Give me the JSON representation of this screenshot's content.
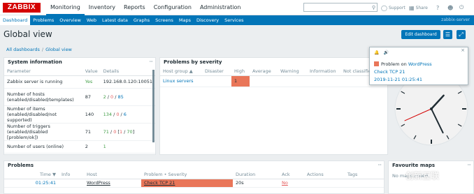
{
  "header": {
    "logo": "ZABBIX",
    "nav": [
      "Monitoring",
      "Inventory",
      "Reports",
      "Configuration",
      "Administration"
    ],
    "active_nav": "Monitoring",
    "support": "Support",
    "share": "Share",
    "help": "?",
    "user_icon": "user-icon",
    "logout_icon": "power-icon"
  },
  "subnav": {
    "items": [
      "Dashboard",
      "Problems",
      "Overview",
      "Web",
      "Latest data",
      "Graphs",
      "Screens",
      "Maps",
      "Discovery",
      "Services"
    ],
    "active": "Dashboard",
    "server_name": "zabbix-server"
  },
  "page": {
    "title": "Global view",
    "edit_button": "Edit dashboard",
    "breadcrumb": [
      "All dashboards",
      "Global view"
    ]
  },
  "system_info": {
    "title": "System information",
    "columns": [
      "Parameter",
      "Value",
      "Details"
    ],
    "rows": [
      {
        "param": "Zabbix server is running",
        "value": "Yes",
        "details": "192.168.0.120:10051"
      },
      {
        "param": "Number of hosts (enabled/disabled/templates)",
        "value": "87",
        "d1": "2",
        "d2": "0",
        "d3": "85"
      },
      {
        "param": "Number of items (enabled/disabled/not supported)",
        "value": "140",
        "d1": "134",
        "d2": "0",
        "d3": "6"
      },
      {
        "param": "Number of triggers (enabled/disabled [problem/ok])",
        "value": "71",
        "d1": "71",
        "d2": "0",
        "d3": "1",
        "d4": "70"
      },
      {
        "param": "Number of users (online)",
        "value": "2",
        "d1": "1"
      }
    ]
  },
  "severity": {
    "title": "Problems by severity",
    "columns": [
      "Host group ▲",
      "Disaster",
      "High",
      "Average",
      "Warning",
      "Information",
      "Not classified"
    ],
    "row": {
      "group": "Linux servers",
      "disaster": "",
      "high": "1",
      "average": "",
      "warning": "",
      "information": "",
      "not_classified": ""
    }
  },
  "problems": {
    "title": "Problems",
    "columns": [
      "Time ▼",
      "Info",
      "Host",
      "Problem • Severity",
      "Duration",
      "Ack",
      "Actions",
      "Tags"
    ],
    "row": {
      "time": "01:25:41",
      "info": "",
      "host": "WordPress",
      "problem": "Check TCP 21",
      "duration": "20s",
      "ack": "No",
      "actions": "",
      "tags": ""
    }
  },
  "favorite_maps": {
    "title": "Favourite maps",
    "empty": "No maps added."
  },
  "notification": {
    "title_prefix": "Problem on ",
    "host": "WordPress",
    "problem": "Check TCP 21",
    "time": "2019-11-21 01:25:41"
  },
  "clock": {
    "hour": 1,
    "minute": 25,
    "second": 41
  },
  "watermark": "创新互联",
  "colors": {
    "accent": "#0275b8",
    "high": "#e97659",
    "brand": "#d40000"
  }
}
